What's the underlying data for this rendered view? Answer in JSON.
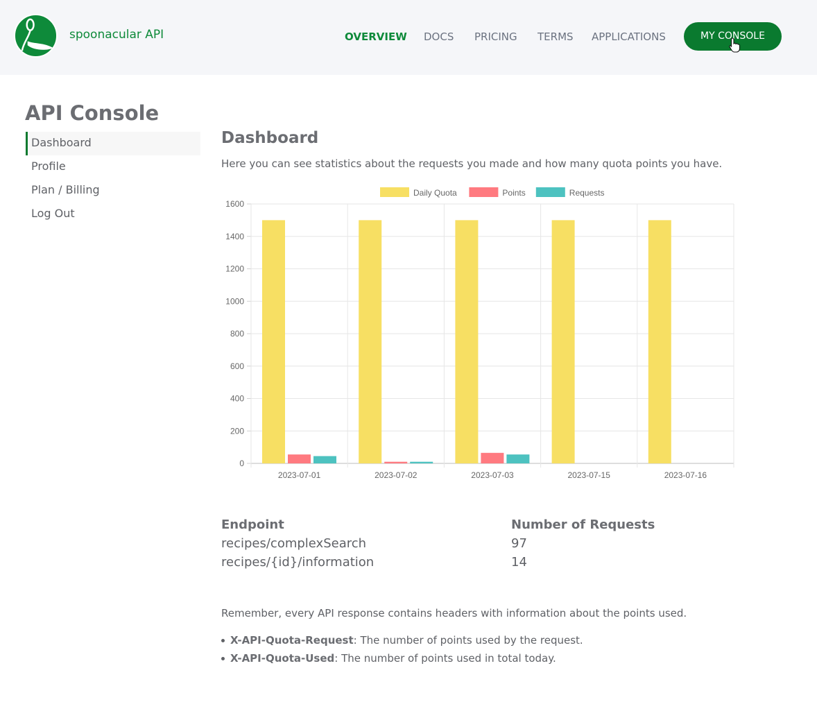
{
  "header": {
    "brand": "spoonacular API",
    "nav": [
      "OVERVIEW",
      "DOCS",
      "PRICING",
      "TERMS",
      "APPLICATIONS"
    ],
    "active_nav": "OVERVIEW",
    "console_button": "MY CONSOLE",
    "accent_color": "#0a7a2f"
  },
  "sidebar": {
    "title": "API Console",
    "items": [
      {
        "label": "Dashboard",
        "active": true
      },
      {
        "label": "Profile",
        "active": false
      },
      {
        "label": "Plan / Billing",
        "active": false
      },
      {
        "label": "Log Out",
        "active": false
      }
    ]
  },
  "main": {
    "title": "Dashboard",
    "intro": "Here you can see statistics about the requests you made and how many quota points you have.",
    "table": {
      "headers": [
        "Endpoint",
        "Number of Requests"
      ],
      "rows": [
        [
          "recipes/complexSearch",
          "97"
        ],
        [
          "recipes/{id}/information",
          "14"
        ]
      ]
    },
    "note": "Remember, every API response contains headers with information about the points used.",
    "bullets": [
      {
        "term": "X-API-Quota-Request",
        "text": ": The number of points used by the request."
      },
      {
        "term": "X-API-Quota-Used",
        "text": ": The number of points used in total today."
      }
    ]
  },
  "chart_data": {
    "type": "bar",
    "categories": [
      "2023-07-01",
      "2023-07-02",
      "2023-07-03",
      "2023-07-15",
      "2023-07-16"
    ],
    "series": [
      {
        "name": "Daily Quota",
        "color": "#f7df63",
        "values": [
          1500,
          1500,
          1500,
          1500,
          1500
        ]
      },
      {
        "name": "Points",
        "color": "#ff7a80",
        "values": [
          55,
          10,
          65,
          0,
          0
        ]
      },
      {
        "name": "Requests",
        "color": "#4dc2c0",
        "values": [
          45,
          10,
          55,
          0,
          0
        ]
      }
    ],
    "y_ticks": [
      "0",
      "200",
      "400",
      "600",
      "800",
      "1000",
      "1200",
      "1400",
      "1600"
    ],
    "ylim": [
      0,
      1600
    ],
    "grid": true,
    "legend": "top"
  }
}
